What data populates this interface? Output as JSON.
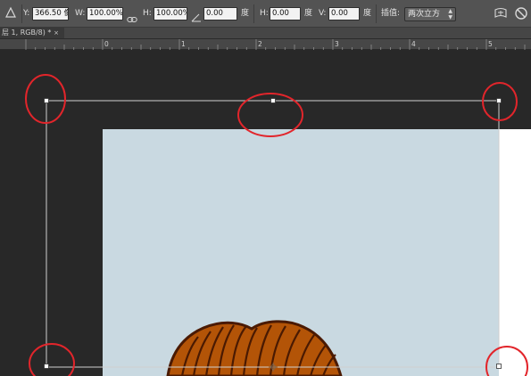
{
  "options_bar": {
    "tool_icon": "triangle-reference-point-icon",
    "y_label": "Y:",
    "y_value": "366.50 像素",
    "w_label": "W:",
    "w_value": "100.00%",
    "link_icon": "chain-link-icon",
    "h_label": "H:",
    "h_value": "100.00%",
    "angle_icon": "angle-icon",
    "rotate_value": "0.00",
    "rotate_unit": "度",
    "hskew_label": "H:",
    "hskew_value": "0.00",
    "hskew_unit": "度",
    "vskew_label": "V:",
    "vskew_value": "0.00",
    "vskew_unit": "度",
    "interp_label": "插值:",
    "interp_value": "两次立方",
    "warp_icon": "warp-mode-icon",
    "cancel_icon": "cancel-transform-icon"
  },
  "document_tab": {
    "title": "层 1, RGB/8) *",
    "close_glyph": "×"
  },
  "ruler": {
    "labels": [
      "0",
      "1",
      "2",
      "3",
      "4",
      "5"
    ]
  },
  "colors": {
    "artboard": "#c9d9e1",
    "pasteboard": "#282828",
    "annotation": "#e2252b",
    "hair_fill": "#b35407",
    "hair_stroke": "#4a1a02"
  }
}
